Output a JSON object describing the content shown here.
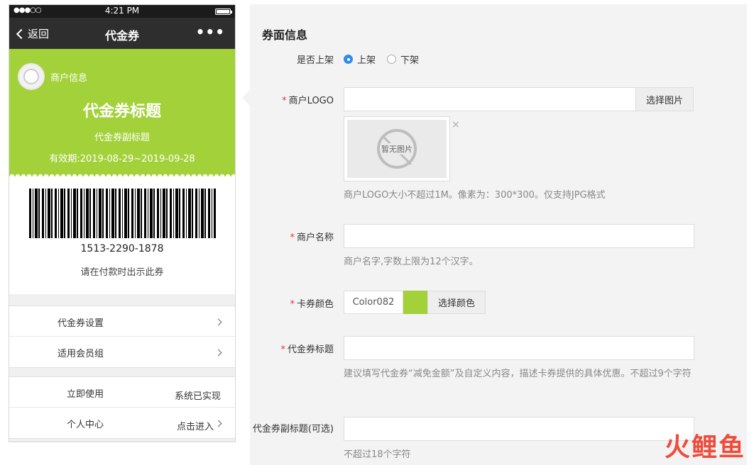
{
  "phone": {
    "status": {
      "signal": "●●●○○",
      "time": "4:21 PM"
    },
    "nav": {
      "back": "返回",
      "title": "代金券",
      "more": "•••"
    },
    "card": {
      "merchant": "商户信息",
      "title": "代金券标题",
      "subtitle": "代金券副标题",
      "validity": "有效期:2019-08-29~2019-09-28",
      "bg_color": "#a3d13a"
    },
    "barcode": {
      "number": "1513-2290-1878",
      "tip": "请在付款时出示此券"
    },
    "menu1": [
      {
        "label": "代金券设置"
      },
      {
        "label": "适用会员组"
      }
    ],
    "menu2": [
      {
        "label": "立即使用",
        "value": "系统已实现"
      },
      {
        "label": "个人中心",
        "value": "点击进入"
      }
    ]
  },
  "form": {
    "section_title": "券面信息",
    "listing": {
      "label": "是否上架",
      "options": [
        "上架",
        "下架"
      ],
      "selected": "上架"
    },
    "logo": {
      "label": "商户LOGO",
      "button": "选择图片",
      "no_image": "暂无图片",
      "close": "×",
      "help": "商户LOGO大小不超过1M。像素为：300*300。仅支持JPG格式"
    },
    "merchant_name": {
      "label": "商户名称",
      "value": "",
      "help": "商户名字,字数上限为12个汉字。"
    },
    "card_color": {
      "label": "卡券颜色",
      "value": "Color082",
      "swatch": "#a3d13a",
      "button": "选择颜色"
    },
    "voucher_title": {
      "label": "代金券标题",
      "value": "",
      "help": "建议填写代金券“减免金额”及自定义内容，描述卡券提供的具体优惠。不超过9个字符"
    },
    "voucher_subtitle": {
      "label": "代金券副标题(可选)",
      "value": "",
      "help": "不超过18个字符"
    },
    "required_mark": "*"
  },
  "watermark": "火鲤鱼"
}
